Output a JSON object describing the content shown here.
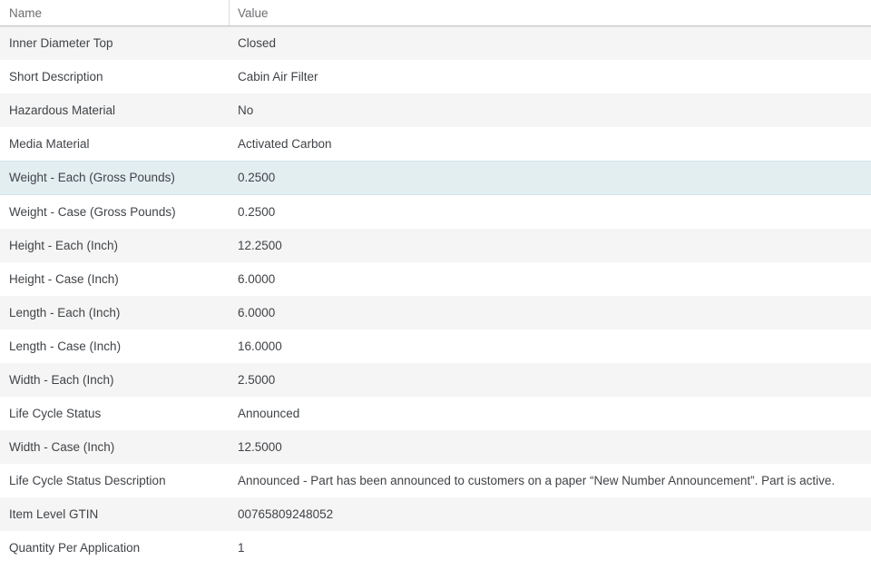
{
  "table": {
    "columns": [
      {
        "label": "Name"
      },
      {
        "label": "Value"
      }
    ],
    "rows": [
      {
        "name": "Inner Diameter Top",
        "value": "Closed",
        "highlighted": false
      },
      {
        "name": "Short Description",
        "value": "Cabin Air Filter",
        "highlighted": false
      },
      {
        "name": "Hazardous Material",
        "value": "No",
        "highlighted": false
      },
      {
        "name": "Media Material",
        "value": "Activated Carbon",
        "highlighted": false
      },
      {
        "name": "Weight - Each (Gross Pounds)",
        "value": "0.2500",
        "highlighted": true
      },
      {
        "name": "Weight - Case (Gross Pounds)",
        "value": "0.2500",
        "highlighted": false
      },
      {
        "name": "Height - Each (Inch)",
        "value": "12.2500",
        "highlighted": false
      },
      {
        "name": "Height - Case (Inch)",
        "value": "6.0000",
        "highlighted": false
      },
      {
        "name": "Length - Each (Inch)",
        "value": "6.0000",
        "highlighted": false
      },
      {
        "name": "Length - Case (Inch)",
        "value": "16.0000",
        "highlighted": false
      },
      {
        "name": "Width - Each (Inch)",
        "value": "2.5000",
        "highlighted": false
      },
      {
        "name": "Life Cycle Status",
        "value": "Announced",
        "highlighted": false
      },
      {
        "name": "Width - Case (Inch)",
        "value": "12.5000",
        "highlighted": false
      },
      {
        "name": "Life Cycle Status Description",
        "value": "Announced - Part has been announced to customers on a paper “New Number Announcement”. Part is active.",
        "highlighted": false
      },
      {
        "name": "Item Level GTIN",
        "value": "00765809248052",
        "highlighted": false
      },
      {
        "name": "Quantity Per Application",
        "value": "1",
        "highlighted": false
      }
    ],
    "colors": {
      "row_bg": "#ffffff",
      "row_alt_bg": "#f5f5f5",
      "highlight_bg": "#e3eef1",
      "highlight_border": "#d3e3e9",
      "header_text": "#6d6d70",
      "body_text": "#404347",
      "header_border": "#c8c8c8",
      "divider": "#dddddd"
    }
  }
}
